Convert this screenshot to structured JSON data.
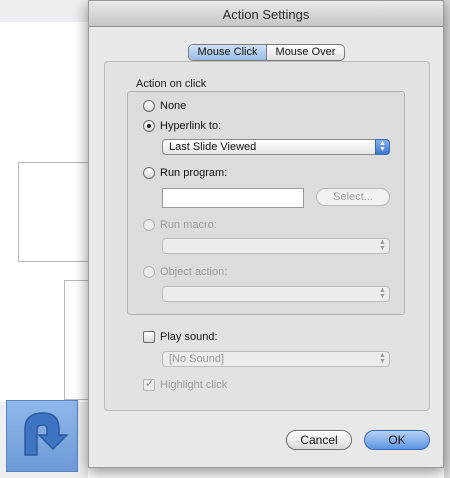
{
  "window": {
    "title": "Action Settings"
  },
  "tabs": [
    {
      "label": "Mouse Click",
      "selected": true
    },
    {
      "label": "Mouse Over",
      "selected": false
    }
  ],
  "group": {
    "label": "Action on click",
    "options": {
      "none": {
        "label": "None",
        "checked": false,
        "enabled": true
      },
      "hyperlink": {
        "label": "Hyperlink to:",
        "checked": true,
        "enabled": true,
        "value": "Last Slide Viewed"
      },
      "run_program": {
        "label": "Run program:",
        "checked": false,
        "enabled": true,
        "input_value": "",
        "select_button": "Select..."
      },
      "run_macro": {
        "label": "Run macro:",
        "checked": false,
        "enabled": false,
        "value": ""
      },
      "object_action": {
        "label": "Object action:",
        "checked": false,
        "enabled": false,
        "value": ""
      }
    },
    "play_sound": {
      "label": "Play sound:",
      "checked": false,
      "value": "[No Sound]"
    },
    "highlight_click": {
      "label": "Highlight click",
      "checked": true,
      "enabled": false
    }
  },
  "buttons": {
    "cancel": "Cancel",
    "ok": "OK"
  },
  "colors": {
    "accent": "#5d95e3",
    "action_button_fill": "#7aa7e0"
  },
  "icons": {
    "popup_arrows": "up-down-arrows-icon",
    "action_shape": "return-arrow-icon"
  }
}
